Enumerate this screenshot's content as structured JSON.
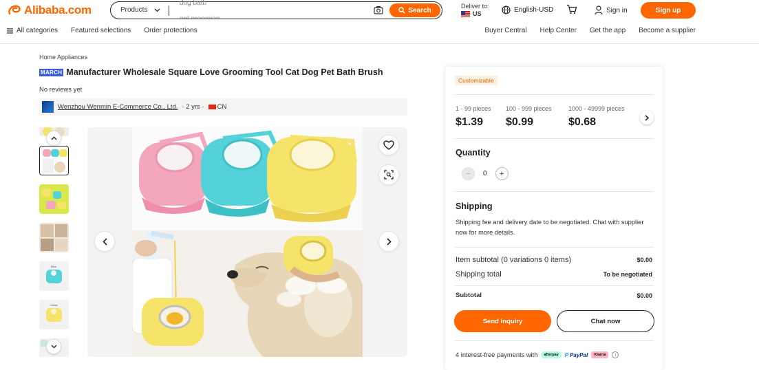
{
  "header": {
    "logo_text": "Alibaba.com",
    "search": {
      "category": "Products",
      "suggestion_1": "dog bath",
      "suggestion_2": "pet grooming",
      "button_label": "Search"
    },
    "deliver": {
      "label": "Deliver to:",
      "country": "US"
    },
    "language": "English-USD",
    "sign_in": "Sign in",
    "sign_up": "Sign up"
  },
  "nav": {
    "left": [
      "All categories",
      "Featured selections",
      "Order protections"
    ],
    "right": [
      "Buyer Central",
      "Help Center",
      "Get the app",
      "Become a supplier"
    ]
  },
  "product": {
    "breadcrumb": "Home Appliances",
    "badge": "MARCH",
    "title": "Manufacturer Wholesale Square Love Grooming Tool Cat Dog Pet Bath Brush",
    "reviews": "No reviews yet",
    "supplier": {
      "name": "Wenzhou Wenmin E-Commerce Co., Ltd.",
      "years": "· 2 yrs ·",
      "country": "CN"
    },
    "thumb_labels": [
      "Blue",
      "Yellow"
    ]
  },
  "panel": {
    "customizable": "Customizable",
    "tiers": [
      {
        "qty": "1 - 99 pieces",
        "price": "$1.39"
      },
      {
        "qty": "100 - 999 pieces",
        "price": "$0.99"
      },
      {
        "qty": "1000 - 49999 pieces",
        "price": "$0.68"
      }
    ],
    "quantity_title": "Quantity",
    "quantity_value": "0",
    "shipping_title": "Shipping",
    "shipping_text": "Shipping fee and delivery date to be negotiated. Chat with supplier now for more details.",
    "item_subtotal_label": "Item subtotal (0 variations 0 items)",
    "item_subtotal_value": "$0.00",
    "shipping_total_label": "Shipping total",
    "shipping_total_value": "To be negotiated",
    "subtotal_label": "Subtotal",
    "subtotal_value": "$0.00",
    "send_inquiry": "Send inquiry",
    "chat_now": "Chat now",
    "payments_text": "4 interest-free payments with",
    "afterpay": "afterpay",
    "paypal": "PayPal",
    "klarna": "Klarna"
  },
  "colors": {
    "accent": "#ff6600",
    "pink": "#f4a6bd",
    "cyan": "#53d3d9",
    "yellow": "#f6e36a"
  }
}
